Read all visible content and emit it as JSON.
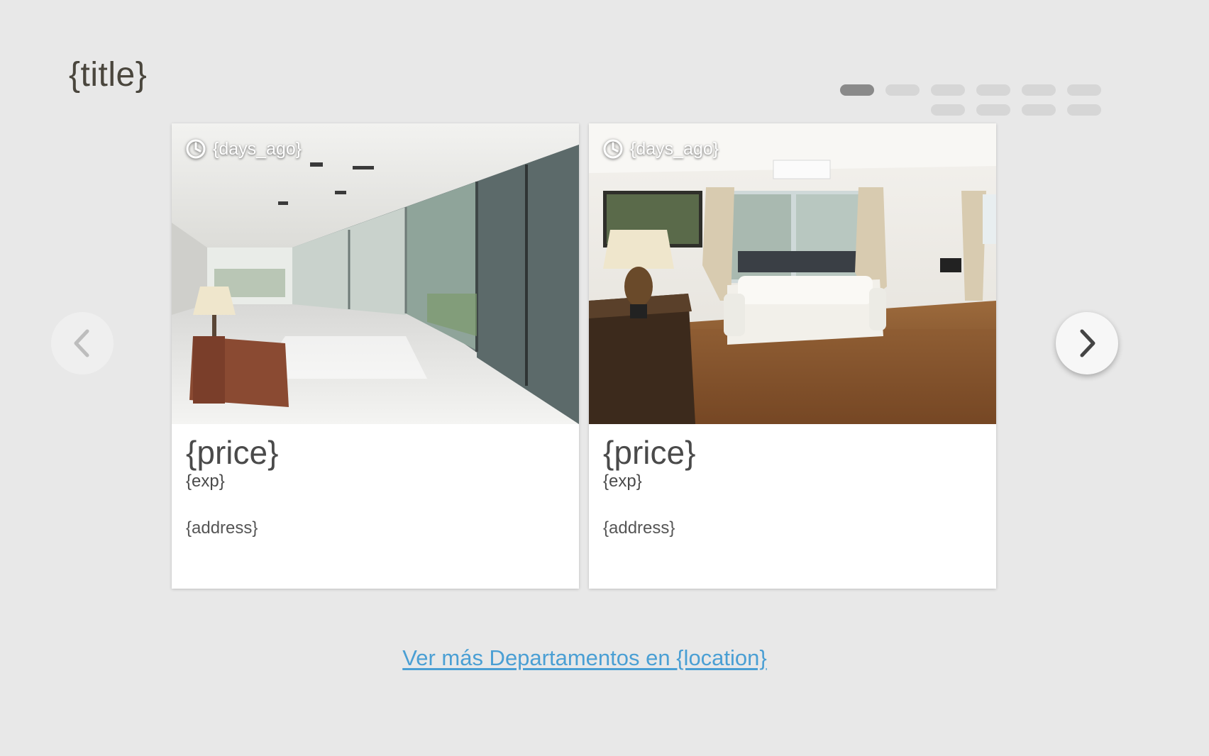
{
  "section": {
    "title": "{title}"
  },
  "pagination": {
    "row1_count": 6,
    "row2_count": 4,
    "active_index": 0
  },
  "nav": {
    "prev_icon": "chevron-left-icon",
    "next_icon": "chevron-right-icon"
  },
  "cards": [
    {
      "days_ago": "{days_ago}",
      "price": "{price}",
      "exp": "{exp}",
      "address": "{address}"
    },
    {
      "days_ago": "{days_ago}",
      "price": "{price}",
      "exp": "{exp}",
      "address": "{address}"
    }
  ],
  "footer": {
    "see_more_label": "Ver más Departamentos en {location}"
  },
  "colors": {
    "background": "#e8e8e8",
    "title": "#4a463d",
    "link": "#4a9fd4",
    "dot_active": "#8a8a8a",
    "dot_inactive": "#d6d6d6"
  }
}
